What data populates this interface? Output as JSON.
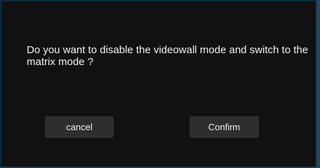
{
  "dialog": {
    "message": "Do you want to disable the videowall mode and switch to the matrix mode ?",
    "cancel_label": "cancel",
    "confirm_label": "Confirm"
  }
}
